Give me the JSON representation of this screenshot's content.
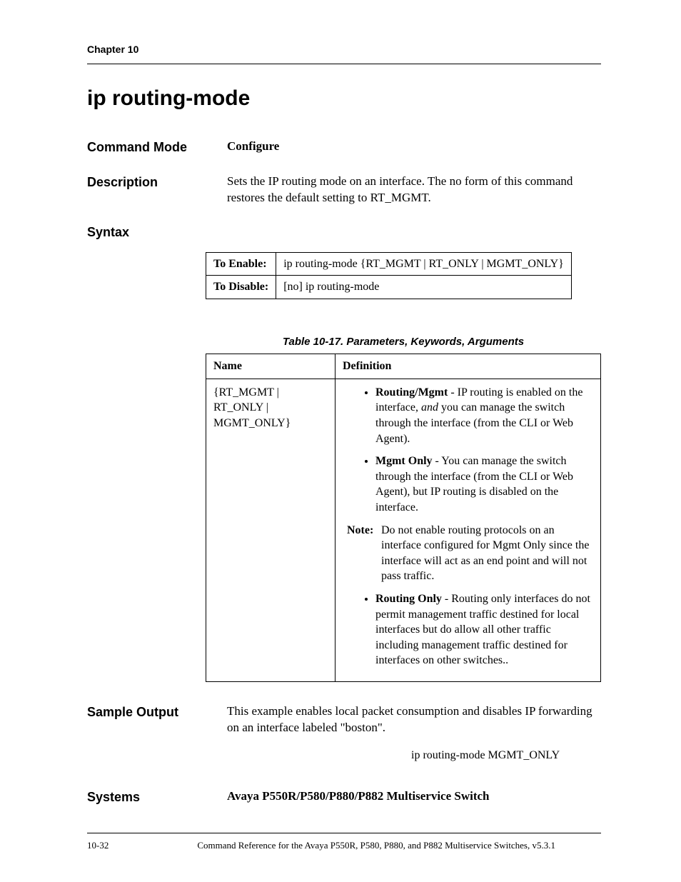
{
  "header": {
    "chapter": "Chapter 10"
  },
  "title": "ip routing-mode",
  "sections": {
    "command_mode": {
      "label": "Command Mode",
      "value": "Configure"
    },
    "description": {
      "label": "Description",
      "value": "Sets the IP routing mode on an interface. The no form of this command restores the default setting to RT_MGMT."
    },
    "syntax": {
      "label": "Syntax"
    },
    "sample_output": {
      "label": "Sample Output",
      "value": "This example enables local packet consumption and disables IP forwarding on an interface labeled \"boston\".",
      "command": "ip routing-mode MGMT_ONLY"
    },
    "systems": {
      "label": "Systems",
      "value": "Avaya P550R/P580/P880/P882 Multiservice Switch"
    }
  },
  "syntax_table": {
    "rows": [
      {
        "label": "To Enable:",
        "value": "ip routing-mode {RT_MGMT | RT_ONLY | MGMT_ONLY}"
      },
      {
        "label": "To Disable:",
        "value": "[no] ip routing-mode"
      }
    ]
  },
  "param_table": {
    "caption": "Table 10-17.  Parameters, Keywords, Arguments",
    "headers": {
      "name": "Name",
      "definition": "Definition"
    },
    "row": {
      "name": "{RT_MGMT | RT_ONLY | MGMT_ONLY}",
      "bullets": {
        "b1_strong": "Routing/Mgmt",
        "b1_pre": " - IP routing is enabled on the interface, ",
        "b1_em": "and",
        "b1_post": " you can manage the switch through the interface (from the CLI or Web Agent).",
        "b2_strong": "Mgmt Only",
        "b2_rest": " - You can manage the switch through the interface (from the CLI or Web Agent), but IP routing is disabled on the interface.",
        "note_label": "Note:",
        "note_text": "Do not enable routing protocols on an interface configured for Mgmt Only since the interface will act as an end point and will not pass traffic.",
        "b3_strong": "Routing Only",
        "b3_rest": " - Routing only interfaces do not permit management traffic destined for local interfaces but do allow all other traffic including management traffic destined for interfaces on other switches.."
      }
    }
  },
  "footer": {
    "page_num": "10-32",
    "text": "Command Reference for the Avaya P550R, P580, P880, and P882 Multiservice Switches, v5.3.1"
  }
}
